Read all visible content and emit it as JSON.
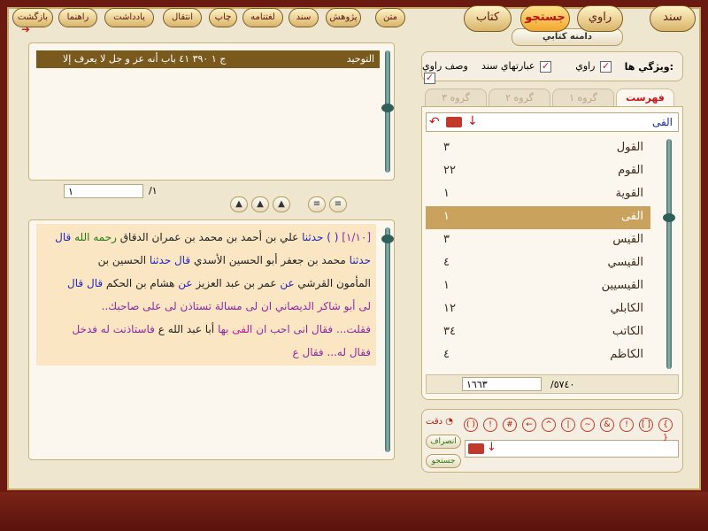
{
  "top_icon": "red-arrow-icon",
  "header_title_button": "دامنه كتابي",
  "features": {
    "label": "ويژگي ها:",
    "items": [
      {
        "label": "راوي",
        "checked": true
      },
      {
        "label": "عبارتهاي سند",
        "checked": true
      },
      {
        "label": "وصف راوي",
        "checked": true
      }
    ]
  },
  "tabs": [
    "فهرست",
    "گروه ١",
    "گروه ٢",
    "گروه ٣"
  ],
  "word_search_value": "الفى",
  "word_list": [
    {
      "word": "القول",
      "count": "٣"
    },
    {
      "word": "القوم",
      "count": "٢٢"
    },
    {
      "word": "القوية",
      "count": "١"
    },
    {
      "word": "الفى",
      "count": "١",
      "selected": true
    },
    {
      "word": "القيس",
      "count": "٣"
    },
    {
      "word": "القيسي",
      "count": "٤"
    },
    {
      "word": "القيسيين",
      "count": "١"
    },
    {
      "word": "الكابلي",
      "count": "١٢"
    },
    {
      "word": "الكاتب",
      "count": "٣٤"
    },
    {
      "word": "الكاظم",
      "count": "٤"
    }
  ],
  "list_footer": {
    "current": "١٦٦٣",
    "total": "/٥٧٤٠"
  },
  "search_panel": {
    "precise_label": "دقت",
    "cancel_label": "انصراف",
    "search_label": "جستجو",
    "symbols": [
      "( )",
      "!",
      "#",
      "←",
      "^",
      "|",
      "~",
      "&",
      "!",
      "[ ]",
      "{ }",
      "O"
    ]
  },
  "header_bar": {
    "book": "التوحيد",
    "location": "ج ١   ٣٩٠   ٤١ باب أنه عز و جل لا يعرف إلا"
  },
  "pager": {
    "current": "١",
    "total": "/١"
  },
  "hadith": {
    "num": "[١/١٠]",
    "lines": [
      [
        {
          "t": "( )",
          "c": "blue"
        },
        {
          "t": " حدثنا ",
          "c": "blue"
        },
        {
          "t": "علي بن أحمد بن محمد بن عمران الدقاق ",
          "c": ""
        },
        {
          "t": "رحمه الله ",
          "c": "green"
        },
        {
          "t": "قال",
          "c": "blue"
        }
      ],
      [
        {
          "t": "حدثنا ",
          "c": "blue"
        },
        {
          "t": "محمد بن جعفر أبو الحسين الأسدي ",
          "c": ""
        },
        {
          "t": "قال حدثنا ",
          "c": "blue"
        },
        {
          "t": "الحسين بن",
          "c": ""
        }
      ],
      [
        {
          "t": "المأمون القرشي ",
          "c": ""
        },
        {
          "t": "عن ",
          "c": "blue"
        },
        {
          "t": "عمر بن عبد العزيز ",
          "c": ""
        },
        {
          "t": "عن ",
          "c": "blue"
        },
        {
          "t": "هشام بن الحكم ",
          "c": ""
        },
        {
          "t": "قال قال",
          "c": "blue"
        }
      ],
      [
        {
          "t": "لى أبو شاكر الديصاني ان لى مسالة تستاذن لى على صاحبك..",
          "c": "purple"
        }
      ],
      [
        {
          "t": "فقلت... فقال انى احب ان ",
          "c": "purple"
        },
        {
          "t": "الفى ",
          "c": "pink"
        },
        {
          "t": "بها ",
          "c": "purple"
        },
        {
          "t": "أبا عبد الله ع ",
          "c": ""
        },
        {
          "t": "فاستاذنت له فدخل",
          "c": "purple"
        }
      ],
      [
        {
          "t": "فقال له... فقال ع",
          "c": "purple"
        }
      ]
    ]
  },
  "bottom_nav": {
    "large": [
      "سند",
      "راوي",
      "جستجو",
      "كتاب"
    ],
    "small": [
      "متن",
      "پژوهش",
      "سند",
      "لغتنامه",
      "چاپ",
      "انتقال",
      "يادداشت",
      "راهنما",
      "بازگشت"
    ]
  },
  "colors": {
    "accent": "#c3171b",
    "frame": "#efe6cf",
    "highlight": "#c9a35e",
    "header": "#7a5a1c"
  }
}
